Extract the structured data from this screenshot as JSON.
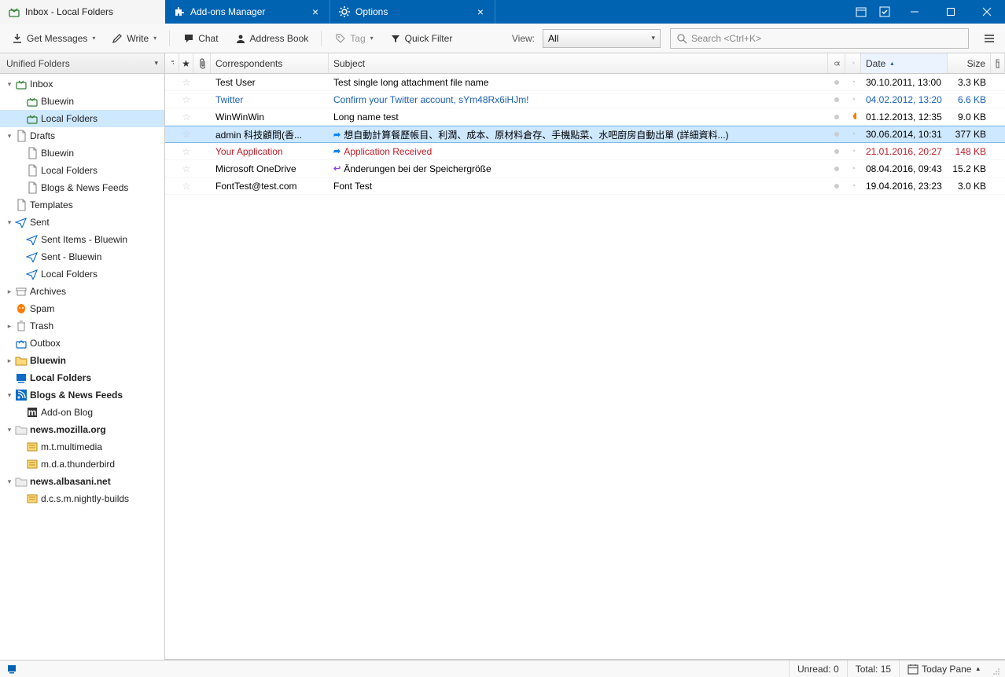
{
  "tabs": [
    {
      "label": "Inbox - Local Folders",
      "closable": false
    },
    {
      "label": "Add-ons Manager",
      "closable": true
    },
    {
      "label": "Options",
      "closable": true
    }
  ],
  "toolbar": {
    "get_messages": "Get Messages",
    "write": "Write",
    "chat": "Chat",
    "address_book": "Address Book",
    "tag": "Tag",
    "quick_filter": "Quick Filter",
    "view_label": "View:",
    "view_value": "All",
    "search_placeholder": "Search <Ctrl+K>"
  },
  "sidebar": {
    "header": "Unified Folders",
    "items": [
      {
        "level": 1,
        "twisty": "▾",
        "icon": "inbox",
        "label": "Inbox",
        "bold": false
      },
      {
        "level": 2,
        "twisty": "",
        "icon": "inbox",
        "label": "Bluewin",
        "bold": false
      },
      {
        "level": 2,
        "twisty": "",
        "icon": "inbox",
        "label": "Local Folders",
        "bold": false,
        "selected": true
      },
      {
        "level": 1,
        "twisty": "▾",
        "icon": "file",
        "label": "Drafts",
        "bold": false
      },
      {
        "level": 2,
        "twisty": "",
        "icon": "file",
        "label": "Bluewin",
        "bold": false
      },
      {
        "level": 2,
        "twisty": "",
        "icon": "file",
        "label": "Local Folders",
        "bold": false
      },
      {
        "level": 2,
        "twisty": "",
        "icon": "file",
        "label": "Blogs & News Feeds",
        "bold": false
      },
      {
        "level": 1,
        "twisty": "",
        "icon": "file",
        "label": "Templates",
        "bold": false
      },
      {
        "level": 1,
        "twisty": "▾",
        "icon": "sent",
        "label": "Sent",
        "bold": false
      },
      {
        "level": 2,
        "twisty": "",
        "icon": "sent",
        "label": "Sent Items - Bluewin",
        "bold": false
      },
      {
        "level": 2,
        "twisty": "",
        "icon": "sent",
        "label": "Sent - Bluewin",
        "bold": false
      },
      {
        "level": 2,
        "twisty": "",
        "icon": "sent",
        "label": "Local Folders",
        "bold": false
      },
      {
        "level": 1,
        "twisty": "▸",
        "icon": "archive",
        "label": "Archives",
        "bold": false
      },
      {
        "level": 1,
        "twisty": "",
        "icon": "spam",
        "label": "Spam",
        "bold": false
      },
      {
        "level": 1,
        "twisty": "▸",
        "icon": "trash",
        "label": "Trash",
        "bold": false
      },
      {
        "level": 1,
        "twisty": "",
        "icon": "outbox",
        "label": "Outbox",
        "bold": false
      },
      {
        "level": 1,
        "twisty": "▸",
        "icon": "folder-mail",
        "label": "Bluewin",
        "bold": true
      },
      {
        "level": 1,
        "twisty": "",
        "icon": "folder-local",
        "label": "Local Folders",
        "bold": true
      },
      {
        "level": 1,
        "twisty": "▾",
        "icon": "rss",
        "label": "Blogs & News Feeds",
        "bold": true
      },
      {
        "level": 2,
        "twisty": "",
        "icon": "rss-item",
        "label": "Add-on Blog",
        "bold": false
      },
      {
        "level": 1,
        "twisty": "▾",
        "icon": "news",
        "label": "news.mozilla.org",
        "bold": true
      },
      {
        "level": 2,
        "twisty": "",
        "icon": "news-item",
        "label": "m.t.multimedia",
        "bold": false
      },
      {
        "level": 2,
        "twisty": "",
        "icon": "news-item",
        "label": "m.d.a.thunderbird",
        "bold": false
      },
      {
        "level": 1,
        "twisty": "▾",
        "icon": "news",
        "label": "news.albasani.net",
        "bold": true
      },
      {
        "level": 2,
        "twisty": "",
        "icon": "news-item",
        "label": "d.c.s.m.nightly-builds",
        "bold": false
      }
    ]
  },
  "columns": {
    "correspondents": "Correspondents",
    "subject": "Subject",
    "date": "Date",
    "size": "Size"
  },
  "messages": [
    {
      "corr": "Test User",
      "subject": "Test single long attachment file name",
      "date": "30.10.2011, 13:00",
      "size": "3.3 KB",
      "style": "",
      "indicator": "",
      "flag": ""
    },
    {
      "corr": "Twitter",
      "subject": "Confirm your Twitter account, sYm48Rx6iHJm!",
      "date": "04.02.2012, 13:20",
      "size": "6.6 KB",
      "style": "link",
      "indicator": "",
      "flag": ""
    },
    {
      "corr": "WinWinWin",
      "subject": "Long name test",
      "date": "01.12.2013, 12:35",
      "size": "9.0 KB",
      "style": "",
      "indicator": "",
      "flag": "fire"
    },
    {
      "corr": "admin 科技顧問(香...",
      "subject": "想自動計算餐歷帳目、利潤、成本、原材料倉存、手機點菜、水吧廚房自動出單 (詳細資料...)",
      "date": "30.06.2014, 10:31",
      "size": "377 KB",
      "style": "",
      "indicator": "fwd",
      "flag": "",
      "selected": true
    },
    {
      "corr": "Your Application",
      "subject": "Application Received",
      "date": "21.01.2016, 20:27",
      "size": "148 KB",
      "style": "red",
      "indicator": "fwd",
      "flag": ""
    },
    {
      "corr": "Microsoft OneDrive",
      "subject": "Änderungen bei der Speichergröße",
      "date": "08.04.2016, 09:43",
      "size": "15.2 KB",
      "style": "",
      "indicator": "rep",
      "flag": ""
    },
    {
      "corr": "FontTest@test.com",
      "subject": "Font Test",
      "date": "19.04.2016, 23:23",
      "size": "3.0 KB",
      "style": "",
      "indicator": "",
      "flag": ""
    }
  ],
  "status": {
    "unread_label": "Unread:",
    "unread_value": "0",
    "total_label": "Total:",
    "total_value": "15",
    "today_pane": "Today Pane"
  }
}
